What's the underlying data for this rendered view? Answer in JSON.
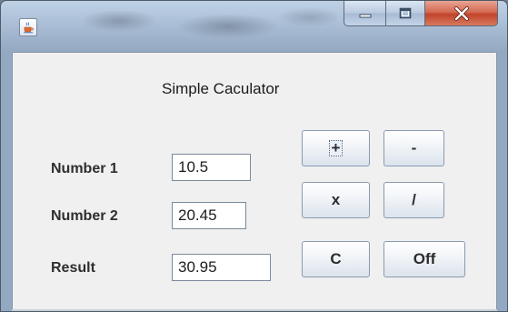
{
  "window": {
    "title": "",
    "icons": {
      "app": "java-cup-icon",
      "minimize": "minimize-icon",
      "maximize": "maximize-icon",
      "close": "close-icon"
    },
    "colors": {
      "client_background": "#f0f0f0",
      "close_button": "#c8452c"
    }
  },
  "calculator": {
    "title": "Simple Caculator",
    "labels": {
      "number1": "Number 1",
      "number2": "Number 2",
      "result": "Result"
    },
    "values": {
      "number1": "10.5",
      "number2": "20.45",
      "result": "30.95"
    },
    "buttons": {
      "add": "+",
      "subtract": "-",
      "multiply": "x",
      "divide": "/",
      "clear": "C",
      "off": "Off"
    }
  }
}
